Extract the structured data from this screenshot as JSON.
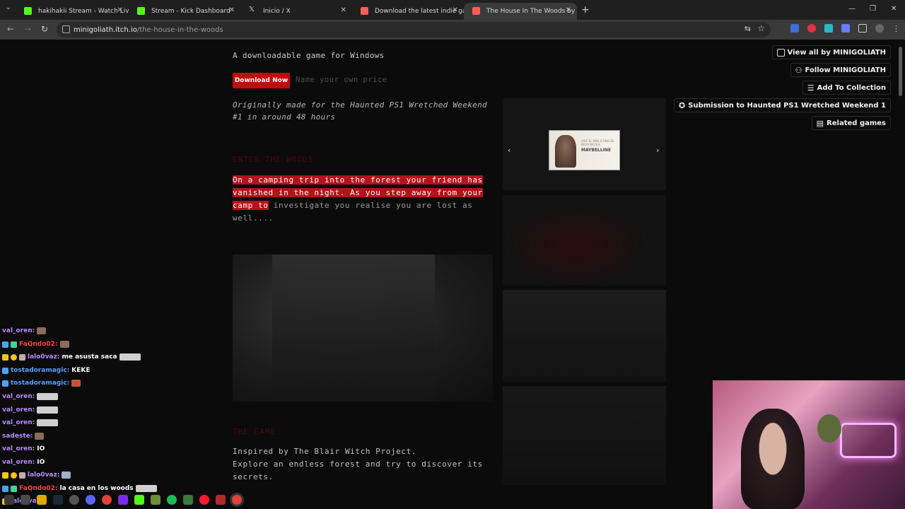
{
  "browser": {
    "tabs": [
      {
        "title": "hakihakii Stream - Watch Live o",
        "color": "#53fc18"
      },
      {
        "title": "Stream - Kick Dashboard",
        "color": "#53fc18"
      },
      {
        "title": "Inicio / X",
        "color": "#dddddd"
      },
      {
        "title": "Download the latest indie game",
        "color": "#fa5c5c"
      },
      {
        "title": "The House In The Woods by M",
        "color": "#fa5c5c"
      }
    ],
    "url_site": "minigoliath.itch.io",
    "url_path": "/the-house-in-the-woods"
  },
  "page": {
    "subtitle": "A downloadable game for Windows",
    "download_label": "Download Now",
    "price_label": "Name your own price",
    "intro": "Originally made for the Haunted PS1 Wretched Weekend #1 in around 48 hours",
    "section1_title": "ENTER THE WOODS",
    "story_highlighted": "On a camping trip into the forest your friend has vanished in the night.  As you step away from your camp to",
    "story_rest": " investigate you realise you are lost as well....",
    "section2_title": "THE GAME",
    "inspired_lines": [
      "Inspired by The Blair Witch Project.",
      "Explore an endless forest and try to discover its secrets."
    ],
    "thumb_brand": "MAYBELLINE",
    "thumb_tag": "VIVE EL MINI ICONO DE NICKI NICOLE"
  },
  "sidebar": {
    "view_all": "View all by MINIGOLIATH",
    "follow": "Follow MINIGOLIATH",
    "add_collection": "Add To Collection",
    "submission": "Submission to Haunted PS1 Wretched Weekend 1",
    "related": "Related games"
  },
  "chat": [
    {
      "user": "val_oren:",
      "color": "#b98cff",
      "text": ""
    },
    {
      "user": "FaQndo02:",
      "color": "#ff4040",
      "text": ""
    },
    {
      "user": "lalo0vaz:",
      "color": "#b98cff",
      "text": "me asusta saca"
    },
    {
      "user": "tostadoramagic:",
      "color": "#5aa0ff",
      "text": "KEKE"
    },
    {
      "user": "tostadoramagic:",
      "color": "#5aa0ff",
      "text": ""
    },
    {
      "user": "val_oren:",
      "color": "#b98cff",
      "text": ""
    },
    {
      "user": "val_oren:",
      "color": "#b98cff",
      "text": ""
    },
    {
      "user": "val_oren:",
      "color": "#b98cff",
      "text": ""
    },
    {
      "user": "sadeste:",
      "color": "#b98cff",
      "text": ""
    },
    {
      "user": "val_oren:",
      "color": "#b98cff",
      "text": "IO"
    },
    {
      "user": "val_oren:",
      "color": "#b98cff",
      "text": "IO"
    },
    {
      "user": "lalo0vaz:",
      "color": "#b98cff",
      "text": ""
    },
    {
      "user": "FaQndo02:",
      "color": "#ff4040",
      "text": "la casa en los woods"
    },
    {
      "user": "lalo0vaz:",
      "color": "#b98cff",
      "text": ""
    }
  ]
}
